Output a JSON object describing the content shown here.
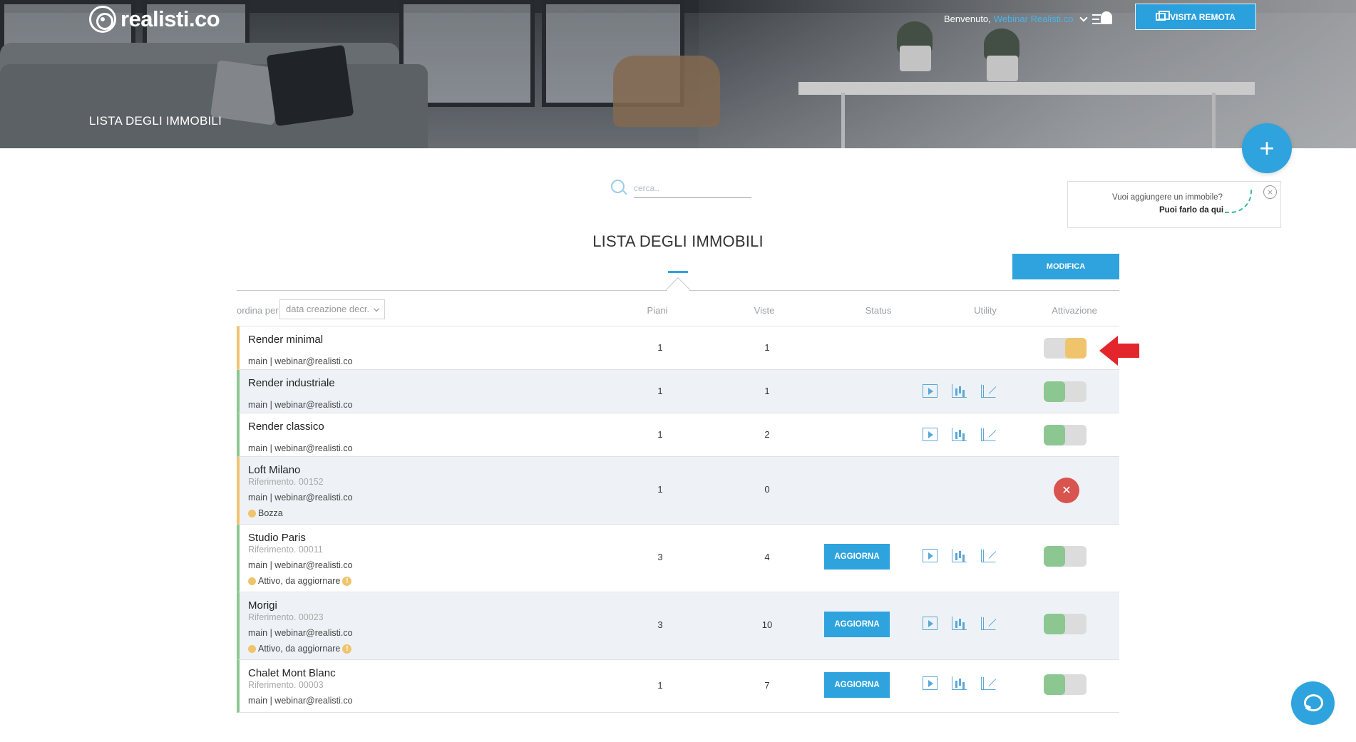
{
  "header": {
    "logo_text": "realisti.co",
    "page_caption": "LISTA DEGLI IMMOBILI",
    "welcome_prefix": "Benvenuto,",
    "user_name": "Webinar Realisti.co",
    "remote_visit_label": "VISITA REMOTA",
    "add_button_label": "+"
  },
  "search": {
    "placeholder": "cerca.."
  },
  "hint": {
    "question": "Vuoi aggiungere un immobile?",
    "answer": "Puoi farlo da qui",
    "close_label": "×"
  },
  "main": {
    "title": "LISTA DEGLI IMMOBILI",
    "edit_button_label": "MODIFICA"
  },
  "table": {
    "order_label": "ordina per",
    "order_value": "data creazione decr.",
    "columns": {
      "piani": "Piani",
      "viste": "Viste",
      "status": "Status",
      "utility": "Utility",
      "attivazione": "Attivazione"
    },
    "update_label": "AGGIORNA",
    "rows": [
      {
        "name": "Render minimal",
        "reference": "",
        "owner": "main | webinar@realisti.co",
        "state": "",
        "piani": "1",
        "viste": "1",
        "activation": "pending"
      },
      {
        "name": "Render industriale",
        "reference": "",
        "owner": "main | webinar@realisti.co",
        "state": "",
        "piani": "1",
        "viste": "1",
        "activation": "on"
      },
      {
        "name": "Render classico",
        "reference": "",
        "owner": "main | webinar@realisti.co",
        "state": "",
        "piani": "1",
        "viste": "2",
        "activation": "on"
      },
      {
        "name": "Loft Milano",
        "reference": "Riferimento. 00152",
        "owner": "main | webinar@realisti.co",
        "state": "Bozza",
        "piani": "1",
        "viste": "0",
        "activation": "none"
      },
      {
        "name": "Studio Paris",
        "reference": "Riferimento. 00011",
        "owner": "main | webinar@realisti.co",
        "state": "Attivo, da aggiornare",
        "piani": "3",
        "viste": "4",
        "activation": "on"
      },
      {
        "name": "Morigi",
        "reference": "Riferimento. 00023",
        "owner": "main | webinar@realisti.co",
        "state": "Attivo, da aggiornare",
        "piani": "3",
        "viste": "10",
        "activation": "on"
      },
      {
        "name": "Chalet Mont Blanc",
        "reference": "Riferimento. 00003",
        "owner": "main | webinar@realisti.co",
        "state": "",
        "piani": "1",
        "viste": "7",
        "activation": "on"
      }
    ]
  },
  "icons": [
    "search-icon",
    "bell-icon",
    "menu-icon",
    "monitor-icon",
    "play-icon",
    "stats-icon",
    "share-icon",
    "close-icon",
    "chat-icon",
    "arrow-left-icon"
  ],
  "colors": {
    "accent": "#2ea3dd",
    "active": "#8cc792",
    "pending": "#f0c46c",
    "danger": "#d9534f",
    "annotation": "#e3262c"
  }
}
